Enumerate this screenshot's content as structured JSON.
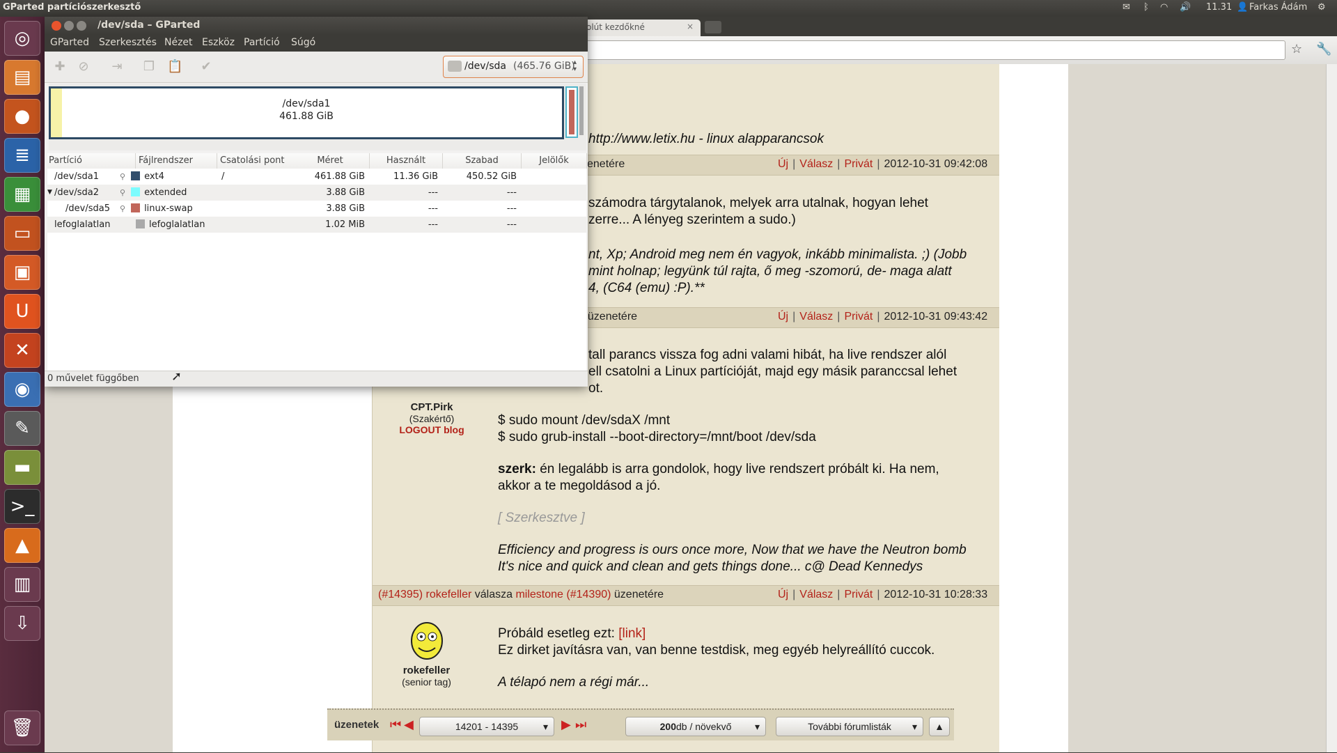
{
  "top_panel": {
    "app_title": "GParted partíciószerkesztő",
    "clock": "11.31",
    "user": "Farkas Ádám"
  },
  "browser": {
    "tab_title": "olút kezdőkné"
  },
  "forum": {
    "frag_link": "http://www.letix.hu - linux alapparancsok",
    "post1_header": {
      "prefix": "enetére",
      "new": "Új",
      "reply": "Válasz",
      "private": "Privát",
      "date": "2012-10-31 09:42:08"
    },
    "post1_text1": "számodra tárgytalanok, melyek arra utalnak, hogyan lehet",
    "post1_text2": "zerre... A lényeg szerintem a sudo.)",
    "post1_sig1": "nt, Xp; Android meg nem én vagyok, inkább minimalista. ;) (Jobb",
    "post1_sig2": "mint holnap; legyünk túl rajta, ő meg -szomorú, de- maga alatt",
    "post1_sig3": "4, (C64 (emu) :P).**",
    "post2_header": {
      "prefix": "ı üzenetére",
      "new": "Új",
      "reply": "Válasz",
      "private": "Privát",
      "date": "2012-10-31 09:43:42"
    },
    "post2_text1": "tall parancs vissza fog adni valami hibát, ha live rendszer alól",
    "post2_text2": "ell csatolni a Linux partícióját, majd egy másik paranccsal lehet",
    "post2_text3": "ot.",
    "post2_author": "CPT.Pirk",
    "post2_rank": "(Szakértő)",
    "post2_blog": "LOGOUT blog",
    "post2_cmd1": "$ sudo mount /dev/sdaX /mnt",
    "post2_cmd2": "$ sudo grub-install --boot-directory=/mnt/boot /dev/sda",
    "post2_edit_label": "szerk:",
    "post2_edit_text1": " én legalább is arra gondolok, hogy live rendszert próbált ki. Ha nem,",
    "post2_edit_text2": "akkor a te megoldásod a jó.",
    "post2_edited": "[ Szerkesztve ]",
    "post2_sig1": "Efficiency and progress is ours once more, Now that we have the Neutron bomb",
    "post2_sig2": "It's nice and quick and clean and gets things done... c@ Dead Kennedys",
    "post3_header": {
      "num": "(#14395)",
      "author": "rokefeller",
      "mid": "válasza",
      "target": "milestone",
      "target_num": "(#14390)",
      "suffix": "üzenetére",
      "new": "Új",
      "reply": "Válasz",
      "private": "Privát",
      "date": "2012-10-31 10:28:33"
    },
    "post3_text1": "Próbáld esetleg ezt: ",
    "post3_link": "[link]",
    "post3_text2": "Ez dirket javításra van, van benne testdisk, meg egyéb helyreállító cuccok.",
    "post3_author": "rokefeller",
    "post3_rank": "(senior tag)",
    "post3_sig": "A télapó nem a régi már...",
    "pager_label": "üzenetek",
    "pager_range": "14201 - 14395",
    "pager_per_page_num": "200",
    "pager_per_page": " db / növekvő",
    "pager_more": "További fórumlisták"
  },
  "gparted": {
    "title": "/dev/sda – GParted",
    "menu": [
      "GParted",
      "Szerkesztés",
      "Nézet",
      "Eszköz",
      "Partíció",
      "Súgó"
    ],
    "device": "/dev/sda",
    "device_size": "(465.76 GiB)",
    "bar_partition": "/dev/sda1",
    "bar_size": "461.88 GiB",
    "columns": [
      "Partíció",
      "Fájlrendszer",
      "Csatolási pont",
      "Méret",
      "Használt",
      "Szabad",
      "Jelölők"
    ],
    "rows": [
      {
        "partition": "/dev/sda1",
        "fs": "ext4",
        "fs_color": "#314e6c",
        "mount": "/",
        "size": "461.88 GiB",
        "used": "11.36 GiB",
        "free": "450.52 GiB",
        "flags": ""
      },
      {
        "partition": "/dev/sda2",
        "fs": "extended",
        "fs_color": "#7dfcfe",
        "mount": "",
        "size": "3.88 GiB",
        "used": "---",
        "free": "---",
        "flags": ""
      },
      {
        "partition": "/dev/sda5",
        "fs": "linux-swap",
        "fs_color": "#c1665a",
        "mount": "",
        "size": "3.88 GiB",
        "used": "---",
        "free": "---",
        "flags": ""
      },
      {
        "partition": "lefoglalatlan",
        "fs": "lefoglalatlan",
        "fs_color": "#a9a9a9",
        "mount": "",
        "size": "1.02 MiB",
        "used": "---",
        "free": "---",
        "flags": ""
      }
    ],
    "status": "0 művelet függőben"
  }
}
